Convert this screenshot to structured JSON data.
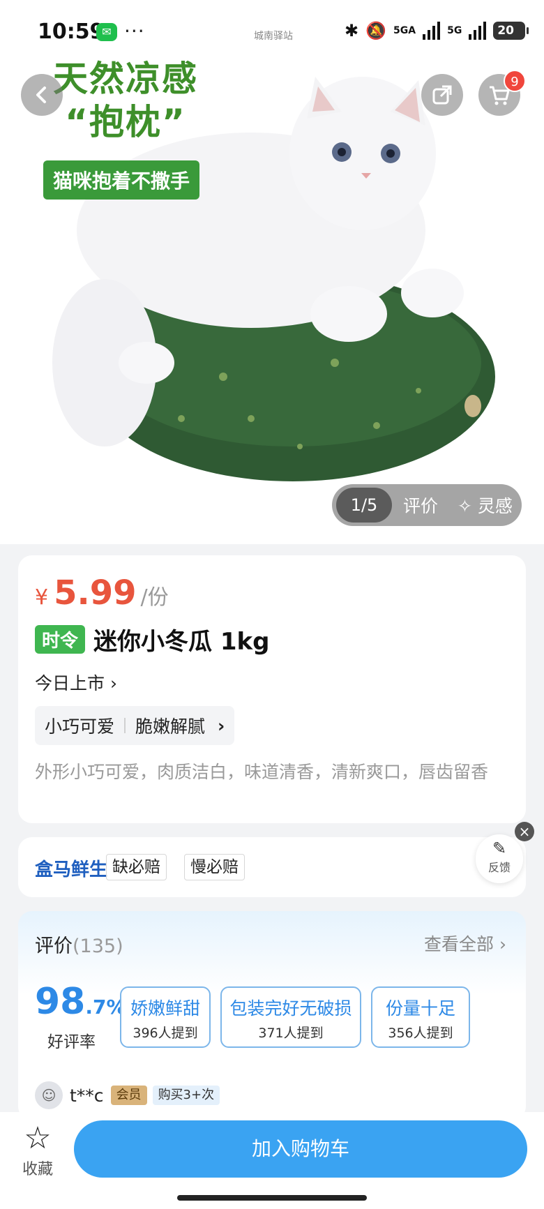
{
  "status_bar": {
    "time": "10:59",
    "more": "···",
    "carrier_tag": "城南驿站",
    "signal1": "5GA",
    "signal2": "5G",
    "battery": "20"
  },
  "nav": {
    "back_icon": "chevron-left-icon",
    "share_icon": "share-icon",
    "cart_icon": "cart-icon",
    "cart_badge": "9"
  },
  "hero": {
    "promo_line1": "天然凉感",
    "promo_line2": "“抱枕”",
    "promo_tag": "猫咪抱着不撒手",
    "indicator_count": "1/5",
    "indicator_review": "评价",
    "indicator_insp": "灵感"
  },
  "product": {
    "price_symbol": "¥",
    "price": "5.99",
    "price_unit": "/份",
    "season_tag": "时令",
    "title": "迷你小冬瓜 1kg",
    "market": "今日上市",
    "feature1": "小巧可爱",
    "feature2": "脆嫩解腻",
    "description": "外形小巧可爱，肉质洁白，味道清香，清新爽口，唇齿留香"
  },
  "guarantee": {
    "brand": "盒马鲜生",
    "tag1": "缺必赔",
    "tag2": "慢必赔"
  },
  "feedback": {
    "label": "反馈",
    "close": "×"
  },
  "reviews": {
    "title": "评价",
    "count": "(135)",
    "view_all": "查看全部",
    "rating_int": "98",
    "rating_dec": ".7%",
    "rating_label": "好评率",
    "keywords": [
      {
        "text": "娇嫩鲜甜",
        "count": "396人提到"
      },
      {
        "text": "包装完好无破损",
        "count": "371人提到"
      },
      {
        "text": "份量十足",
        "count": "356人提到"
      }
    ],
    "reviewer": {
      "name": "t**c",
      "member": "会员",
      "purchase": "购买3+次"
    }
  },
  "bottom": {
    "fav_label": "收藏",
    "add_cart": "加入购物车"
  },
  "colors": {
    "price": "#e8553d",
    "accent_blue": "#3aa3f2",
    "season_green": "#3fb650",
    "promo_green": "#3e8f2a"
  }
}
